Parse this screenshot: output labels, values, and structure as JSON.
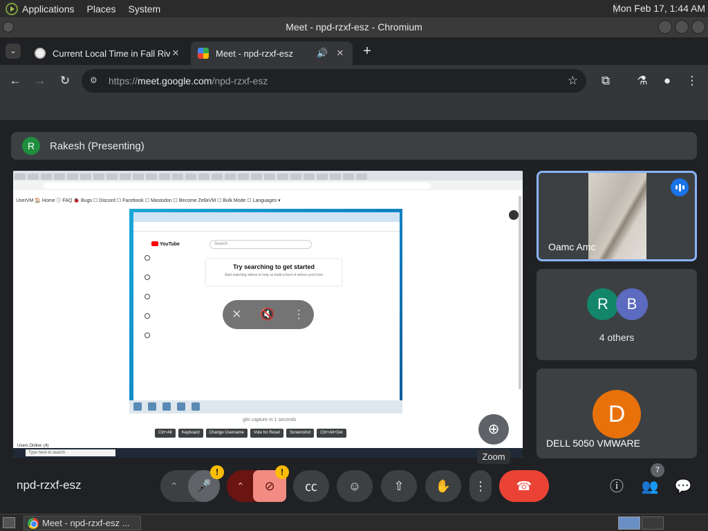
{
  "gnome": {
    "menus": [
      "Applications",
      "Places",
      "System"
    ],
    "clock": "Mon Feb 17,  1:44 AM"
  },
  "window": {
    "title": "Meet - npd-rzxf-esz - Chromium"
  },
  "tabs": [
    {
      "title": "Current Local Time in Fall Riv",
      "icon": "clock-favicon-icon"
    },
    {
      "title": "Meet - npd-rzxf-esz",
      "icon": "google-meet-favicon-icon",
      "active": true
    }
  ],
  "toolbar": {
    "url_prefix": "https://",
    "url_host": "meet.google.com",
    "url_path": "/npd-rzxf-esz"
  },
  "meet": {
    "presenter": {
      "initial": "R",
      "label": "Rakesh (Presenting)"
    },
    "shared_screen": {
      "bookmarks": "UserVM   🏠 Home  ⓘ FAQ  🐞 Bugs  ☐ Discord  ☐ Facebook  ☐ Mastodon  ☐ Become ZellaVM  ☐ Bulk Mode  ☐ Languages ▾",
      "yt_search_placeholder": "Search",
      "yt_logo": "YouTube",
      "yt_heading": "Try searching to get started",
      "yt_subtext": "Start watching videos to help us build a feed of videos you'll love",
      "caption": "gits capture in 1 seconds",
      "buttons": [
        "Ctrl+Alt",
        "Keyboard",
        "Change Username",
        "Vote for Reset",
        "Screenshot",
        "Ctrl+Alt+Del"
      ],
      "users_label": "Users Online: (4)",
      "taskbar_search": "Type here to search"
    },
    "zoom_tooltip": "Zoom",
    "participants": [
      {
        "name": "Oamc Amc",
        "speaking": true
      },
      {
        "initials": [
          "R",
          "B"
        ],
        "avatar_colors": [
          "#12856b",
          "#5c6bc0"
        ],
        "label": "4 others"
      },
      {
        "initial": "D",
        "name": "DELL 5050 VMWARE",
        "avatar_color": "#e8710a"
      }
    ],
    "meeting_code": "npd-rzxf-esz",
    "people_count": "7",
    "warning_glyph": "!"
  },
  "os_taskbar": {
    "task_title": "Meet - npd-rzxf-esz ..."
  }
}
